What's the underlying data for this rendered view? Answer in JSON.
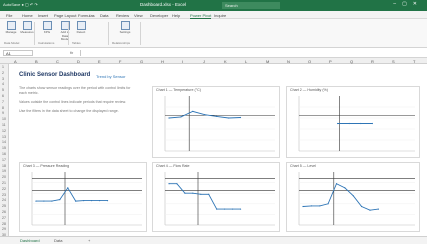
{
  "window": {
    "title": "Dashboard.xlsx - Excel",
    "search_placeholder": "Search",
    "quick_access": "AutoSave  ●  ▢  ↶  ↷"
  },
  "ribbon_tabs": [
    "File",
    "Home",
    "Insert",
    "Page Layout",
    "Formulas",
    "Data",
    "Review",
    "View",
    "Developer",
    "Help",
    "Power Pivot",
    "Inquire"
  ],
  "active_tab": "Power Pivot",
  "ribbon": {
    "buttons": [
      "Manage",
      "Measures",
      "KPIs",
      "Add to Data Model",
      "Detect",
      "Settings"
    ],
    "groups": [
      "Data Model",
      "Calculations",
      "Tables",
      "Relationships"
    ]
  },
  "formula_bar": {
    "name_box": "A1",
    "fx": "fx",
    "value": ""
  },
  "columns": [
    "A",
    "B",
    "C",
    "D",
    "E",
    "F",
    "G",
    "H",
    "I",
    "J",
    "K",
    "L",
    "M",
    "N",
    "O",
    "P",
    "Q",
    "R",
    "S",
    "T"
  ],
  "rows": [
    "1",
    "2",
    "3",
    "4",
    "5",
    "6",
    "7",
    "8",
    "9",
    "10",
    "11",
    "12",
    "13",
    "14",
    "15",
    "16",
    "17",
    "18",
    "19",
    "20",
    "21",
    "22",
    "23",
    "24",
    "25",
    "26",
    "27",
    "28",
    "29",
    "30"
  ],
  "dashboard": {
    "title": "Clinic Sensor Dashboard",
    "subtitle": "Trend by Sensor",
    "notes": [
      "The charts show sensor readings over the period with control limits for each metric.",
      "Values outside the control lines indicate periods that require review.",
      "Use the filters in the data sheet to change the displayed range."
    ]
  },
  "charts": [
    {
      "id": "c1",
      "title": "Chart 1 — Temperature (°C)"
    },
    {
      "id": "c2",
      "title": "Chart 2 — Humidity (%)"
    },
    {
      "id": "c3",
      "title": "Chart 3 — Pressure Reading"
    },
    {
      "id": "c4",
      "title": "Chart 4 — Flow Rate"
    },
    {
      "id": "c5",
      "title": "Chart 5 — Level"
    }
  ],
  "chart_data": [
    {
      "type": "line",
      "x": [
        0,
        1,
        2,
        3,
        4,
        5,
        6
      ],
      "values": [
        0.6,
        0.62,
        0.72,
        0.66,
        0.63,
        0.6,
        0.61
      ],
      "ylim": [
        0,
        1
      ]
    },
    {
      "type": "line",
      "x": [
        0,
        1,
        2,
        3
      ],
      "values": [
        0.5,
        0.5,
        0.5,
        0.5
      ],
      "ylim": [
        0,
        1
      ]
    },
    {
      "type": "line",
      "x": [
        0,
        1,
        2,
        3,
        4,
        5,
        6,
        7,
        8,
        9
      ],
      "values": [
        0.45,
        0.45,
        0.45,
        0.48,
        0.7,
        0.45,
        0.46,
        0.46,
        0.46,
        0.46
      ],
      "ylim": [
        0,
        1
      ]
    },
    {
      "type": "line",
      "x": [
        0,
        1,
        2,
        3,
        4,
        5,
        6,
        7,
        8,
        9
      ],
      "values": [
        0.78,
        0.78,
        0.6,
        0.6,
        0.58,
        0.58,
        0.3,
        0.3,
        0.3,
        0.3
      ],
      "ylim": [
        0,
        1
      ]
    },
    {
      "type": "line",
      "x": [
        0,
        1,
        2,
        3,
        4,
        5,
        6,
        7,
        8,
        9
      ],
      "values": [
        0.35,
        0.36,
        0.36,
        0.4,
        0.78,
        0.7,
        0.55,
        0.35,
        0.28,
        0.3
      ],
      "ylim": [
        0,
        1
      ]
    }
  ],
  "sheet_tabs": [
    "Dashboard",
    "Data",
    "+"
  ]
}
